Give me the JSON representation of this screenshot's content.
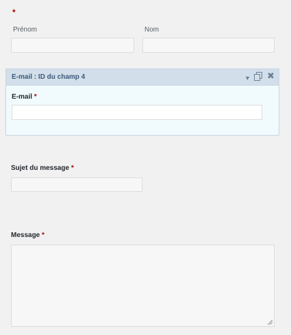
{
  "name_field": {
    "required_star": "*",
    "first_label": "Prénom",
    "last_label": "Nom"
  },
  "email_field": {
    "header_title": "E-mail : ID du champ 4",
    "label": "E-mail",
    "required_star": "*",
    "icons": [
      "chevron-down-icon",
      "duplicate-icon",
      "close-icon"
    ]
  },
  "subject_field": {
    "label": "Sujet du message",
    "required_star": "*"
  },
  "message_field": {
    "label": "Message",
    "required_star": "*"
  },
  "colors": {
    "required": "#aa0000",
    "selected_header_bg": "#d2dfea",
    "selected_body_bg": "#f1fafd",
    "page_bg": "#f1f1f1"
  }
}
